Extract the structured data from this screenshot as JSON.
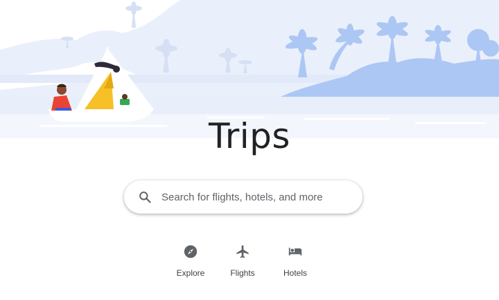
{
  "page": {
    "title": "Trips"
  },
  "search": {
    "placeholder": "Search for flights, hotels, and more",
    "value": "",
    "icon": "search-icon"
  },
  "quick_links": [
    {
      "label": "Explore",
      "icon": "compass-icon"
    },
    {
      "label": "Flights",
      "icon": "airplane-icon"
    },
    {
      "label": "Hotels",
      "icon": "bed-icon"
    }
  ],
  "colors": {
    "sky": "#e8effb",
    "island": "#aec8f5",
    "background_palms": "#d3def5",
    "sail": "#f6c026",
    "shirt": "#ea4335",
    "text": "#202124",
    "icon": "#5f6368"
  }
}
